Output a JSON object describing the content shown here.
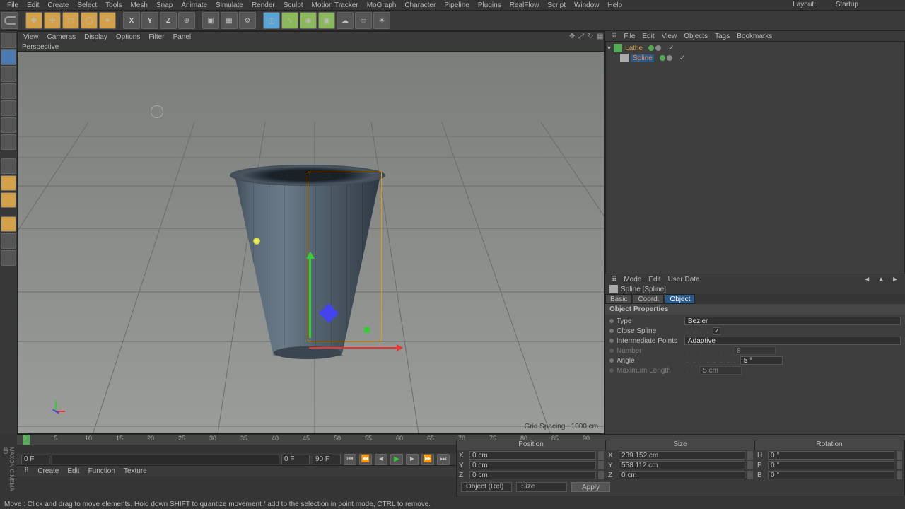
{
  "menubar": {
    "items": [
      "File",
      "Edit",
      "Create",
      "Select",
      "Tools",
      "Mesh",
      "Snap",
      "Animate",
      "Simulate",
      "Render",
      "Sculpt",
      "Motion Tracker",
      "MoGraph",
      "Character",
      "Pipeline",
      "Plugins",
      "RealFlow",
      "Script",
      "Window",
      "Help"
    ]
  },
  "layout": {
    "label": "Layout:",
    "value": "Startup"
  },
  "viewport": {
    "menu": [
      "View",
      "Cameras",
      "Display",
      "Options",
      "Filter",
      "Panel"
    ],
    "label": "Perspective",
    "grid_spacing": "Grid Spacing : 1000 cm"
  },
  "object_manager": {
    "menu": [
      "File",
      "Edit",
      "View",
      "Objects",
      "Tags",
      "Bookmarks"
    ],
    "tree": [
      {
        "name": "Lathe",
        "indent": 0,
        "sel": false
      },
      {
        "name": "Spline",
        "indent": 1,
        "sel": true
      }
    ]
  },
  "attribute_manager": {
    "menu": [
      "Mode",
      "Edit",
      "User Data"
    ],
    "title": "Spline [Spline]",
    "tabs": [
      {
        "label": "Basic",
        "active": false
      },
      {
        "label": "Coord.",
        "active": false
      },
      {
        "label": "Object",
        "active": true
      }
    ],
    "section": "Object Properties",
    "props": {
      "type": {
        "label": "Type",
        "value": "Bezier"
      },
      "close": {
        "label": "Close Spline",
        "checked": true
      },
      "interp": {
        "label": "Intermediate Points",
        "value": "Adaptive"
      },
      "number": {
        "label": "Number",
        "value": "8"
      },
      "angle": {
        "label": "Angle",
        "value": "5 °"
      },
      "maxlen": {
        "label": "Maximum Length",
        "value": "5 cm"
      }
    }
  },
  "timeline": {
    "ticks": [
      "0",
      "5",
      "10",
      "15",
      "20",
      "25",
      "30",
      "35",
      "40",
      "45",
      "50",
      "55",
      "60",
      "65",
      "70",
      "75",
      "80",
      "85",
      "90"
    ],
    "start": "0 F",
    "end": "90 F",
    "cur": "0 F",
    "range_end": "90 F"
  },
  "materials": {
    "menu": [
      "Create",
      "Edit",
      "Function",
      "Texture"
    ]
  },
  "coords": {
    "headers": [
      "Position",
      "Size",
      "Rotation"
    ],
    "rows": [
      {
        "axis": "X",
        "pos": "0 cm",
        "size": "239.152 cm",
        "rotlbl": "H",
        "rot": "0 °"
      },
      {
        "axis": "Y",
        "pos": "0 cm",
        "size": "558.112 cm",
        "rotlbl": "P",
        "rot": "0 °"
      },
      {
        "axis": "Z",
        "pos": "0 cm",
        "size": "0 cm",
        "rotlbl": "B",
        "rot": "0 °"
      }
    ],
    "mode": "Object (Rel)",
    "sizemode": "Size",
    "apply": "Apply"
  },
  "status": "Move : Click and drag to move elements. Hold down SHIFT to quantize movement / add to the selection in point mode, CTRL to remove."
}
